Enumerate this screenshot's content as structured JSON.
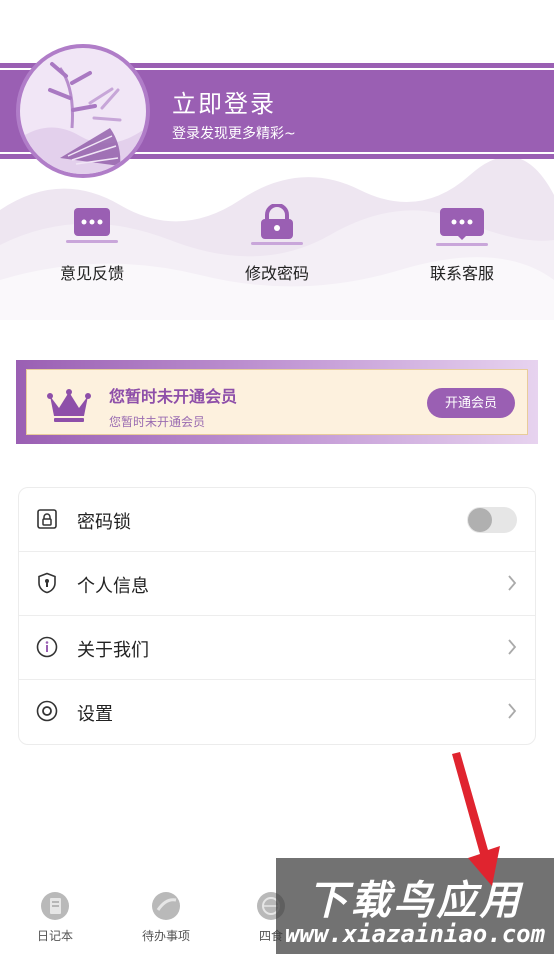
{
  "header": {
    "title": "立即登录",
    "subtitle": "登录发现更多精彩~"
  },
  "quick_actions": [
    {
      "label": "意见反馈",
      "icon": "chat-bubble-icon"
    },
    {
      "label": "修改密码",
      "icon": "padlock-icon"
    },
    {
      "label": "联系客服",
      "icon": "customer-service-icon"
    }
  ],
  "vip": {
    "title": "您暂时未开通会员",
    "subtitle": "您暂时未开通会员",
    "button": "开通会员"
  },
  "settings": {
    "items": [
      {
        "label": "密码锁",
        "icon": "lock-icon",
        "control": "toggle",
        "toggle_on": false
      },
      {
        "label": "个人信息",
        "icon": "shield-user-icon",
        "control": "chevron"
      },
      {
        "label": "关于我们",
        "icon": "info-icon",
        "control": "chevron"
      },
      {
        "label": "设置",
        "icon": "settings-circle-icon",
        "control": "chevron"
      }
    ]
  },
  "tabbar": {
    "tabs": [
      {
        "label": "日记本"
      },
      {
        "label": "待办事项"
      },
      {
        "label": "四食"
      }
    ]
  },
  "watermark": {
    "line1": "下载鸟应用",
    "line2": "www.xiazainiao.com"
  },
  "colors": {
    "brand_purple": "#9a5fb3",
    "vip_bg": "#fdf1de",
    "arrow_red": "#e0242f"
  }
}
